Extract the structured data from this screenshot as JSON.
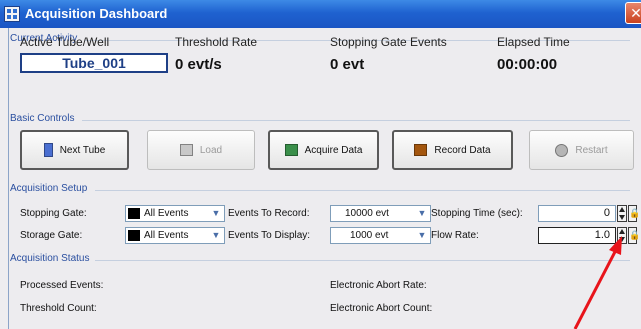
{
  "window": {
    "title": "Acquisition Dashboard",
    "close_glyph": "✕"
  },
  "current_activity": {
    "heading": "Current Activity",
    "active_tube_label": "Active Tube/Well",
    "active_tube_value": "Tube_001",
    "threshold_rate_label": "Threshold Rate",
    "threshold_rate_value": "0 evt/s",
    "stopping_gate_events_label": "Stopping Gate Events",
    "stopping_gate_events_value": "0 evt",
    "elapsed_time_label": "Elapsed Time",
    "elapsed_time_value": "00:00:00"
  },
  "basic_controls": {
    "heading": "Basic Controls",
    "buttons": [
      {
        "label": "Next Tube",
        "enabled": true,
        "icon": "next-tube-icon",
        "icon_color": "#4a6fd1"
      },
      {
        "label": "Load",
        "enabled": false,
        "icon": "load-icon",
        "icon_color": "#c8c8c8"
      },
      {
        "label": "Acquire Data",
        "enabled": true,
        "icon": "acquire-icon",
        "icon_color": "#3a8f4a"
      },
      {
        "label": "Record Data",
        "enabled": true,
        "icon": "record-icon",
        "icon_color": "#a3560e"
      },
      {
        "label": "Restart",
        "enabled": false,
        "icon": "restart-icon",
        "icon_color": "#b5b5b5"
      }
    ]
  },
  "acquisition_setup": {
    "heading": "Acquisition Setup",
    "stopping_gate_label": "Stopping Gate:",
    "stopping_gate_value": "All Events",
    "storage_gate_label": "Storage Gate:",
    "storage_gate_value": "All Events",
    "events_to_record_label": "Events To Record:",
    "events_to_record_value": "10000 evt",
    "events_to_display_label": "Events To Display:",
    "events_to_display_value": "1000 evt",
    "stopping_time_label": "Stopping Time (sec):",
    "stopping_time_value": "0",
    "flow_rate_label": "Flow Rate:",
    "flow_rate_value": "1.0",
    "lock_glyph": "🔒"
  },
  "acquisition_status": {
    "heading": "Acquisition Status",
    "processed_events_label": "Processed Events:",
    "threshold_count_label": "Threshold Count:",
    "electronic_abort_rate_label": "Electronic Abort Rate:",
    "electronic_abort_count_label": "Electronic Abort Count:"
  },
  "colors": {
    "title_bar": "#1f62d0",
    "annotation_arrow": "#e8141b",
    "section_heading": "#2a4fa0"
  }
}
